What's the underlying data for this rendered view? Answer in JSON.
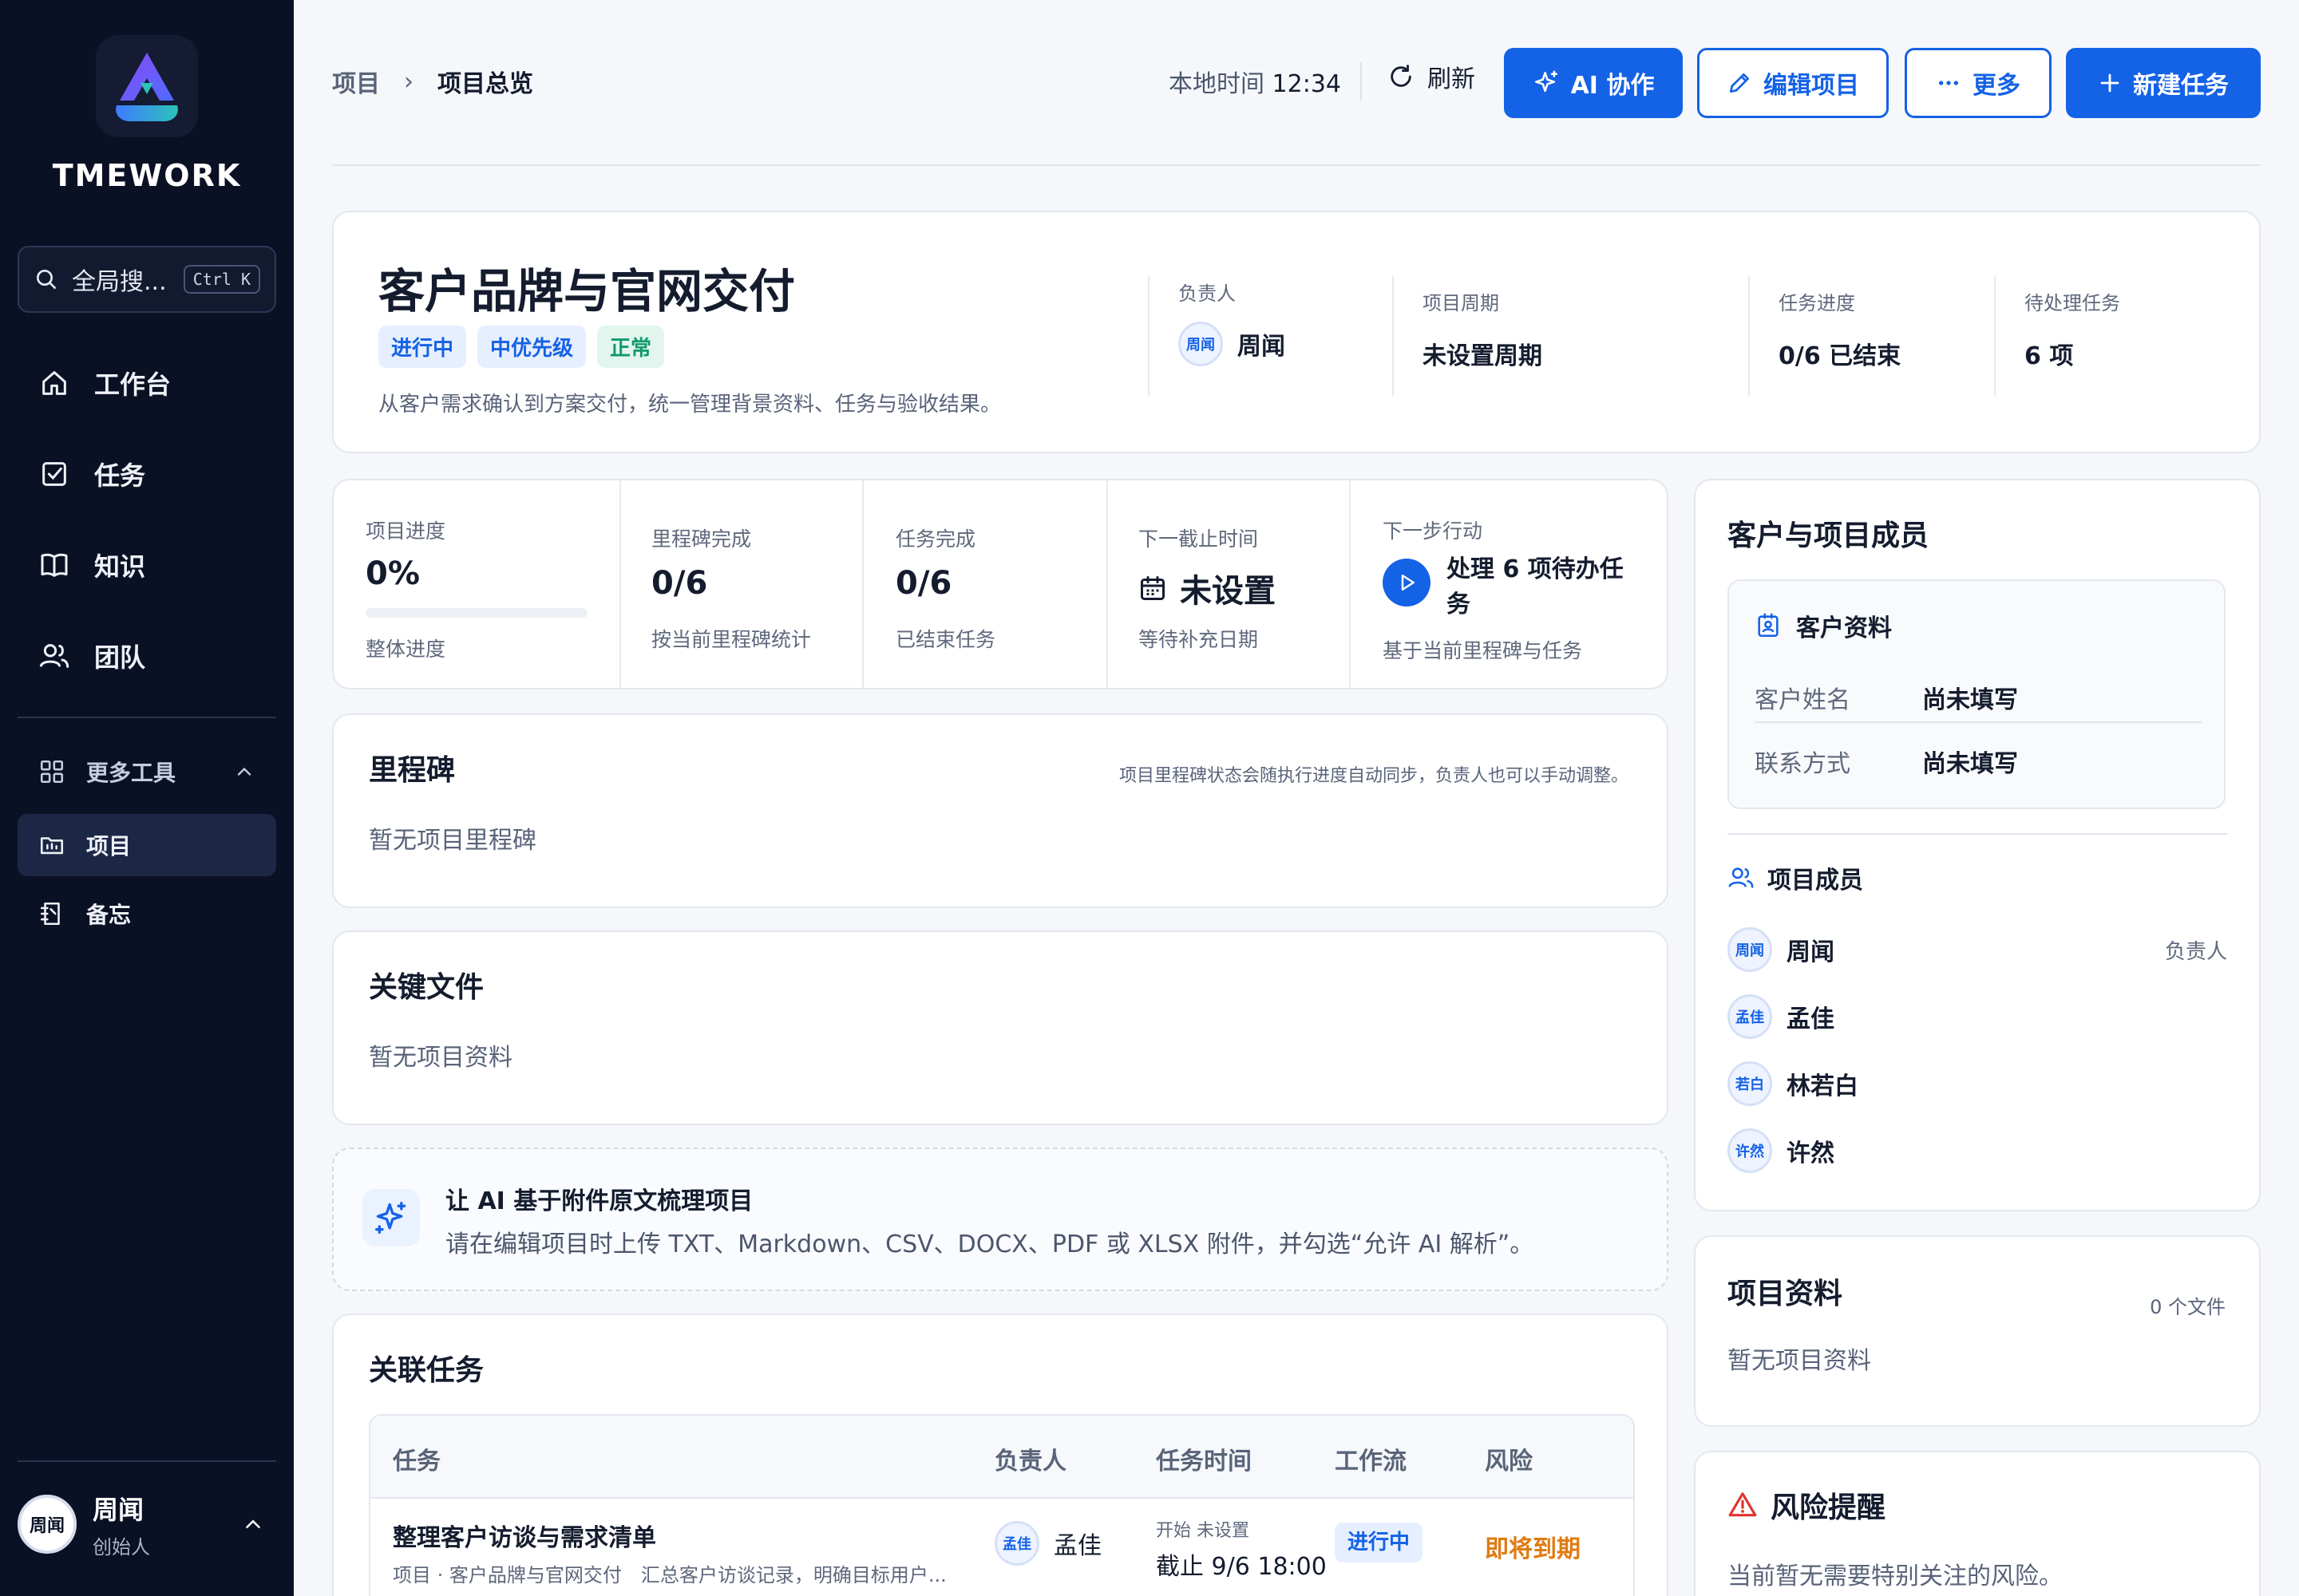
{
  "sidebar": {
    "brand": "TMEWORK",
    "search_label": "全局搜...",
    "search_shortcut": "Ctrl K",
    "nav": [
      {
        "label": "工作台",
        "icon": "home-icon"
      },
      {
        "label": "任务",
        "icon": "checkbox-icon"
      },
      {
        "label": "知识",
        "icon": "book-icon"
      },
      {
        "label": "团队",
        "icon": "users-icon"
      }
    ],
    "more_tools": "更多工具",
    "tools": [
      {
        "label": "项目",
        "icon": "folder-icon",
        "active": true
      },
      {
        "label": "备忘",
        "icon": "notebook-icon",
        "active": false
      }
    ],
    "user": {
      "avatar": "周闻",
      "name": "周闻",
      "role": "创始人"
    }
  },
  "header": {
    "breadcrumb": [
      "项目",
      "项目总览"
    ],
    "clock_label": "本地时间",
    "clock_time": "12:34",
    "refresh": "刷新",
    "ai_button": "AI 协作",
    "edit_button": "编辑项目",
    "more_button": "更多",
    "new_task_button": "新建任务"
  },
  "project": {
    "title": "客户品牌与官网交付",
    "tags": [
      "进行中",
      "中优先级",
      "正常"
    ],
    "description": "从客户需求确认到方案交付，统一管理背景资料、任务与验收结果。",
    "owner_label": "负责人",
    "owner_avatar": "周闻",
    "owner": "周闻",
    "period_label": "项目周期",
    "period": "未设置周期",
    "progress_label": "任务进度",
    "progress": "0/6 已结束",
    "pending_label": "待处理任务",
    "pending": "6 项"
  },
  "stats": {
    "progress": {
      "label": "项目进度",
      "value": "0%",
      "fraction": 0,
      "sub": "整体进度"
    },
    "milestones": {
      "label": "里程碑完成",
      "value": "0/6",
      "sub": "按当前里程碑统计"
    },
    "tasks": {
      "label": "任务完成",
      "value": "0/6",
      "sub": "已结束任务"
    },
    "deadline": {
      "label": "下一截止时间",
      "value": "未设置",
      "sub": "等待补充日期"
    },
    "next": {
      "label": "下一步行动",
      "value": "处理 6 项待办任务",
      "sub": "基于当前里程碑与任务"
    }
  },
  "milestones": {
    "title": "里程碑",
    "note": "项目里程碑状态会随执行进度自动同步，负责人也可以手动调整。",
    "empty": "暂无项目里程碑"
  },
  "files": {
    "title": "关键文件",
    "empty": "暂无项目资料"
  },
  "ai_hint": {
    "title": "让 AI 基于附件原文梳理项目",
    "desc": "请在编辑项目时上传 TXT、Markdown、CSV、DOCX、PDF 或 XLSX 附件，并勾选“允许 AI 解析”。"
  },
  "tasks": {
    "title": "关联任务",
    "columns": [
      "任务",
      "负责人",
      "任务时间",
      "工作流",
      "风险"
    ],
    "rows": [
      {
        "name": "整理客户访谈与需求清单",
        "sub": "项目 · 客户品牌与官网交付　汇总客户访谈记录，明确目标用户...",
        "owner_avatar": "孟佳",
        "owner": "孟佳",
        "start": "开始 未设置",
        "end": "截止 9/6 18:00",
        "flow": "进行中",
        "risk": "即将到期"
      }
    ]
  },
  "members_card": {
    "title": "客户与项目成员",
    "client_title": "客户资料",
    "client_name_label": "客户姓名",
    "client_name": "尚未填写",
    "contact_label": "联系方式",
    "contact": "尚未填写",
    "members_title": "项目成员",
    "members": [
      {
        "avatar": "周闻",
        "name": "周闻",
        "role": "负责人"
      },
      {
        "avatar": "孟佳",
        "name": "孟佳",
        "role": ""
      },
      {
        "avatar": "若白",
        "name": "林若白",
        "role": ""
      },
      {
        "avatar": "许然",
        "name": "许然",
        "role": ""
      }
    ]
  },
  "project_files": {
    "title": "项目资料",
    "count": "0 个文件",
    "empty": "暂无项目资料"
  },
  "risk_card": {
    "title": "风险提醒",
    "text": "当前暂无需要特别关注的风险。"
  },
  "colors": {
    "primary": "#1462e6",
    "sidebar_bg": "#0b1124",
    "warning": "#e07b12",
    "success": "#12996a",
    "danger": "#e0342b"
  }
}
